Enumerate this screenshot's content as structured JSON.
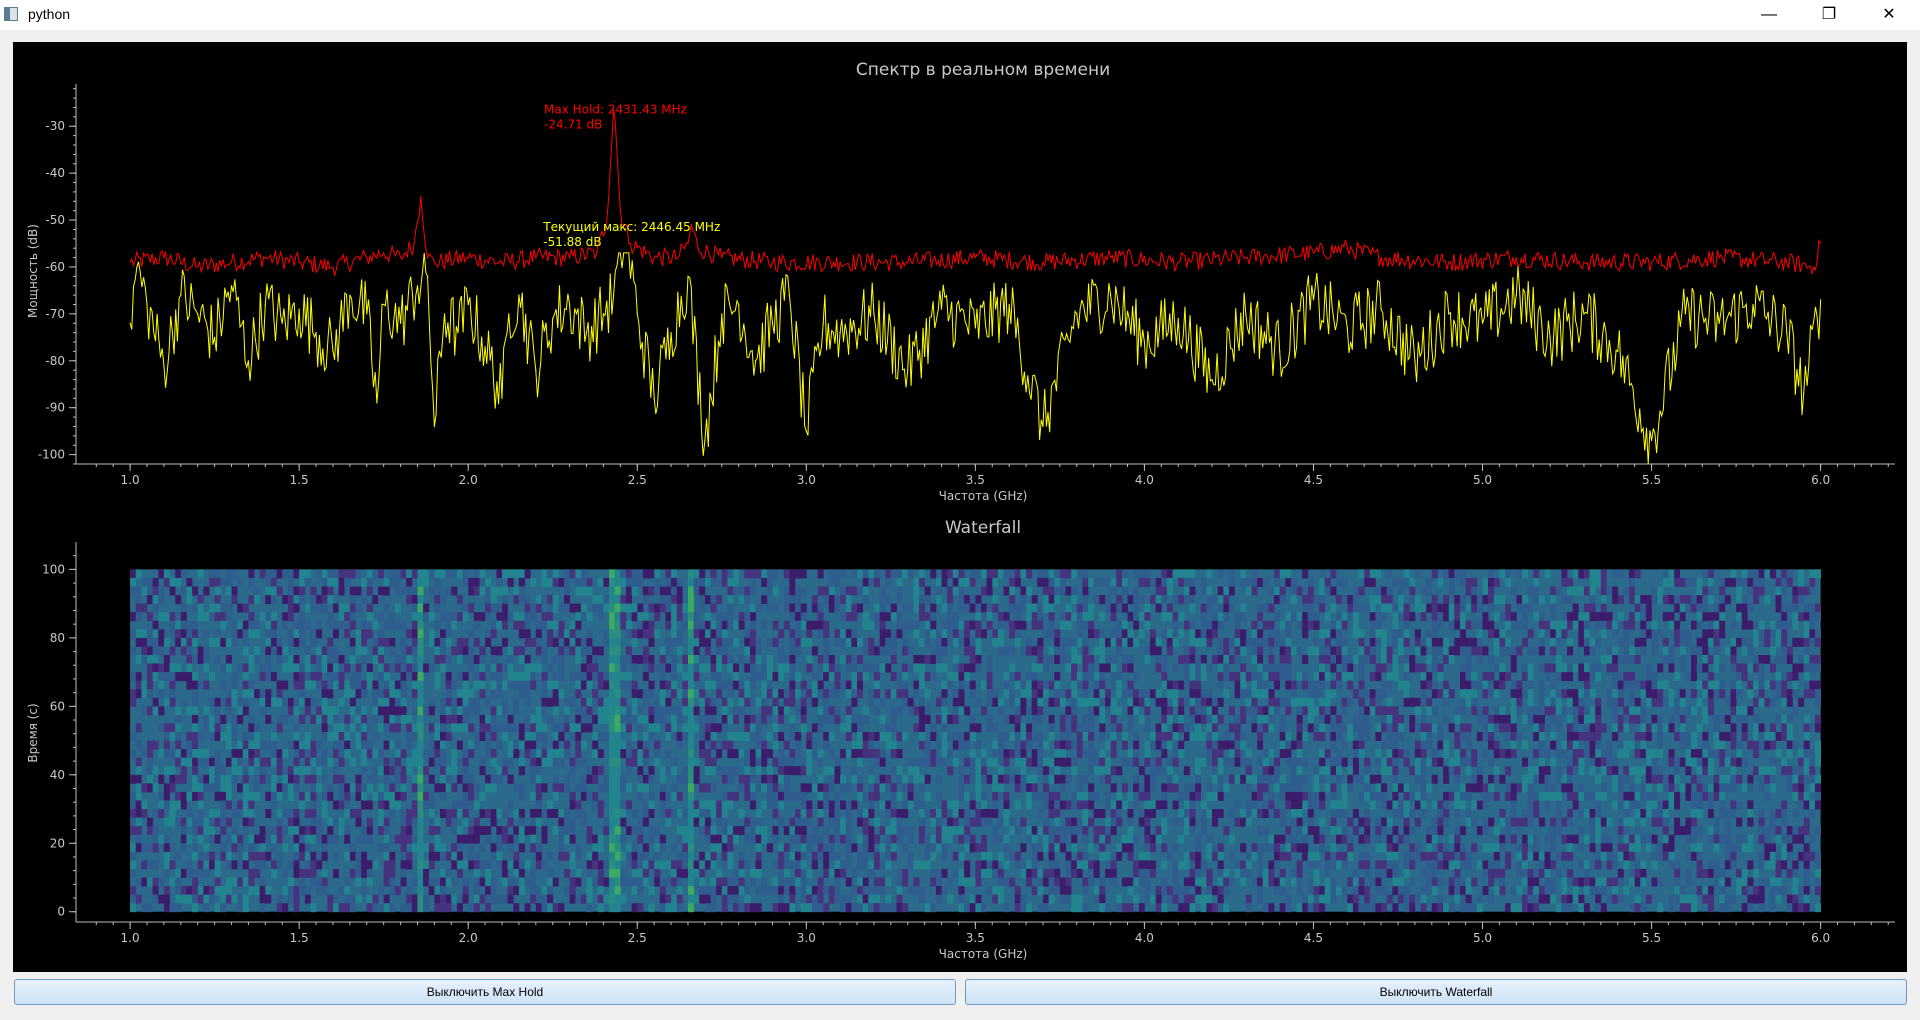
{
  "window": {
    "title": "python",
    "icon": "app-window-icon"
  },
  "buttons": {
    "max_hold": "Выключить Max Hold",
    "waterfall": "Выключить Waterfall"
  },
  "chart_data": [
    {
      "type": "line",
      "title": "Спектр в реальном времени",
      "xlabel": "Частота (GHz)",
      "ylabel": "Мощность (dB)",
      "xlim": [
        0.84,
        6.22
      ],
      "ylim": [
        -102,
        -21
      ],
      "xticks": [
        1.0,
        1.5,
        2.0,
        2.5,
        3.0,
        3.5,
        4.0,
        4.5,
        5.0,
        5.5,
        6.0
      ],
      "yticks": [
        -100,
        -90,
        -80,
        -70,
        -60,
        -50,
        -40,
        -30
      ],
      "grid": false,
      "series": [
        {
          "color": "#ff0000",
          "x": [
            1.0,
            1.1,
            1.2,
            1.3,
            1.4,
            1.5,
            1.6,
            1.7,
            1.75,
            1.8,
            1.84,
            1.86,
            1.88,
            1.9,
            2.0,
            2.1,
            2.2,
            2.3,
            2.38,
            2.41,
            2.4314,
            2.45,
            2.48,
            2.55,
            2.62,
            2.65,
            2.66,
            2.68,
            2.75,
            2.9,
            3.1,
            3.3,
            3.5,
            3.7,
            3.9,
            4.1,
            4.3,
            4.5,
            4.6,
            4.7,
            4.9,
            5.1,
            5.3,
            5.5,
            5.7,
            5.9,
            5.98,
            6.0
          ],
          "y": [
            -59,
            -58,
            -60,
            -59,
            -58,
            -59,
            -60,
            -58,
            -57,
            -58,
            -55,
            -45,
            -58,
            -59,
            -58,
            -59,
            -58,
            -58,
            -57,
            -50,
            -24.71,
            -48,
            -55,
            -58,
            -58,
            -55,
            -51,
            -56,
            -58,
            -59,
            -59,
            -59,
            -58,
            -59,
            -58,
            -59,
            -58,
            -57,
            -56,
            -58,
            -59,
            -58,
            -59,
            -59,
            -58,
            -59,
            -60,
            -55
          ]
        },
        {
          "color": "#ffff00",
          "x": [
            1.0,
            1.02,
            1.05,
            1.1,
            1.15,
            1.2,
            1.25,
            1.3,
            1.35,
            1.4,
            1.45,
            1.5,
            1.55,
            1.6,
            1.65,
            1.7,
            1.73,
            1.75,
            1.8,
            1.85,
            1.88,
            1.9,
            1.93,
            1.97,
            2.0,
            2.05,
            2.1,
            2.12,
            2.15,
            2.2,
            2.25,
            2.3,
            2.35,
            2.4,
            2.43,
            2.4645,
            2.5,
            2.55,
            2.6,
            2.65,
            2.7,
            2.75,
            2.8,
            2.85,
            2.9,
            2.95,
            3.0,
            3.05,
            3.1,
            3.2,
            3.3,
            3.4,
            3.5,
            3.6,
            3.7,
            3.8,
            3.9,
            4.0,
            4.1,
            4.2,
            4.3,
            4.4,
            4.5,
            4.6,
            4.7,
            4.8,
            4.9,
            5.0,
            5.1,
            5.2,
            5.3,
            5.4,
            5.5,
            5.6,
            5.7,
            5.8,
            5.9,
            5.95,
            6.0
          ],
          "y": [
            -72,
            -60,
            -68,
            -81,
            -66,
            -70,
            -75,
            -64,
            -80,
            -68,
            -72,
            -69,
            -74,
            -78,
            -66,
            -70,
            -89,
            -68,
            -72,
            -64,
            -62,
            -94,
            -70,
            -74,
            -68,
            -77,
            -88,
            -70,
            -66,
            -82,
            -71,
            -68,
            -74,
            -70,
            -66,
            -51.88,
            -70,
            -88,
            -74,
            -62,
            -97,
            -70,
            -68,
            -80,
            -72,
            -66,
            -95,
            -72,
            -74,
            -70,
            -82,
            -69,
            -73,
            -68,
            -94,
            -70,
            -66,
            -76,
            -71,
            -84,
            -70,
            -78,
            -67,
            -73,
            -69,
            -80,
            -70,
            -72,
            -66,
            -75,
            -70,
            -78,
            -97,
            -70,
            -72,
            -68,
            -74,
            -87,
            -67
          ]
        }
      ],
      "annotations": [
        {
          "color": "#ff0000",
          "line1": "Max Hold: 2431.43 MHz",
          "line2": "-24.71 dB",
          "x": 2.4314,
          "y": -24.71
        },
        {
          "color": "#ffff00",
          "line1": "Текущий макс: 2446.45 MHz",
          "line2": "-51.88 dB",
          "x": 2.4645,
          "y": -51.88
        }
      ]
    },
    {
      "type": "heatmap",
      "title": "Waterfall",
      "xlabel": "Частота (GHz)",
      "ylabel": "Время (с)",
      "xlim": [
        0.84,
        6.22
      ],
      "ylim": [
        -3,
        108
      ],
      "extent": {
        "x": [
          1.0,
          6.0
        ],
        "y": [
          0,
          100
        ]
      },
      "xticks": [
        1.0,
        1.5,
        2.0,
        2.5,
        3.0,
        3.5,
        4.0,
        4.5,
        5.0,
        5.5,
        6.0
      ],
      "yticks": [
        0,
        20,
        40,
        60,
        80,
        100
      ],
      "colormap": [
        "#3b1d6b",
        "#46337e",
        "#2f5e8e",
        "#2a738e",
        "#22848e",
        "#2a8e7f",
        "#3daa63"
      ],
      "hot_columns": [
        1.86,
        2.43,
        2.66
      ]
    }
  ]
}
